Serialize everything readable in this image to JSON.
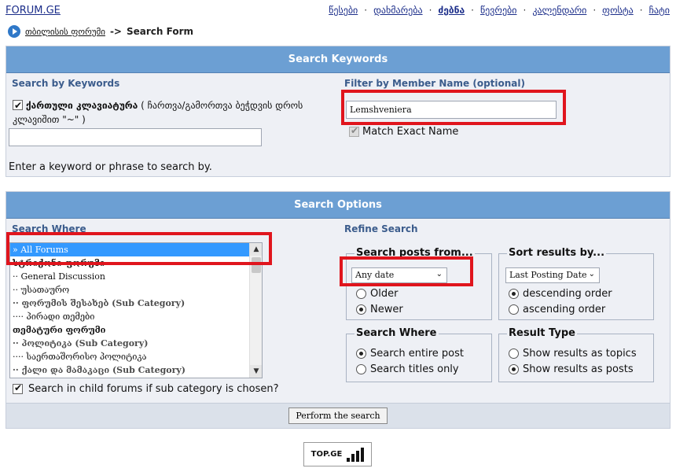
{
  "site_title": "FORUM.GE",
  "nav": [
    "წესები",
    "დახმარება",
    "ძებნა",
    "წევრები",
    "კალენდარი",
    "ფოსტა",
    "ჩატი"
  ],
  "nav_active": "ძებნა",
  "breadcrumb": {
    "link": "თბილისის ფორუმი",
    "separator": "->",
    "current": "Search Form"
  },
  "keywords_panel": {
    "title": "Search Keywords",
    "left_heading": "Search by Keywords",
    "right_heading": "Filter by Member Name (optional)",
    "georgian_kb_label": "ქართული კლავიატურა",
    "georgian_kb_note": "( ჩართვა/გამორთვა ბეჭდვის დროს კლავიშით \"~\" )",
    "keyword_value": "",
    "hint": "Enter a keyword or phrase to search by.",
    "member_name": "Lemshveniera",
    "match_exact_label": "Match Exact Name"
  },
  "options_panel": {
    "title": "Search Options",
    "left_heading": "Search Where",
    "right_heading": "Refine Search",
    "forums": [
      {
        "label": "» All Forums",
        "type": "sel"
      },
      {
        "label": "სტრიქონი ფორუმი",
        "type": "cat"
      },
      {
        "label": "·· General Discussion",
        "type": "item"
      },
      {
        "label": "·· უსათაურო",
        "type": "item"
      },
      {
        "label": "·· ფორუმის შესახებ (Sub Category)",
        "type": "subcat"
      },
      {
        "label": "···· პირადი თემები",
        "type": "item"
      },
      {
        "label": "თემატური ფორუმი",
        "type": "cat"
      },
      {
        "label": "·· პოლიტიკა (Sub Category)",
        "type": "subcat"
      },
      {
        "label": "···· საერთაშორისო პოლიტიკა",
        "type": "item"
      },
      {
        "label": "·· ქალი და მამაკაცი (Sub Category)",
        "type": "subcat"
      }
    ],
    "child_forums_label": "Search in child forums if sub category is chosen?",
    "posts_from": {
      "legend": "Search posts from...",
      "select_value": "Any date",
      "options": [
        "Older",
        "Newer"
      ],
      "selected": "Newer"
    },
    "sort_by": {
      "legend": "Sort results by...",
      "select_value": "Last Posting Date",
      "options": [
        "descending order",
        "ascending order"
      ],
      "selected": "descending order"
    },
    "search_where": {
      "legend": "Search Where",
      "options": [
        "Search entire post",
        "Search titles only"
      ],
      "selected": "Search entire post"
    },
    "result_type": {
      "legend": "Result Type",
      "options": [
        "Show results as topics",
        "Show results as posts"
      ],
      "selected": "Show results as posts"
    },
    "submit_label": "Perform the search"
  },
  "badge_text": "TOP.GE",
  "badge_bars": [
    0.3,
    0.55,
    0.8,
    1.0
  ]
}
